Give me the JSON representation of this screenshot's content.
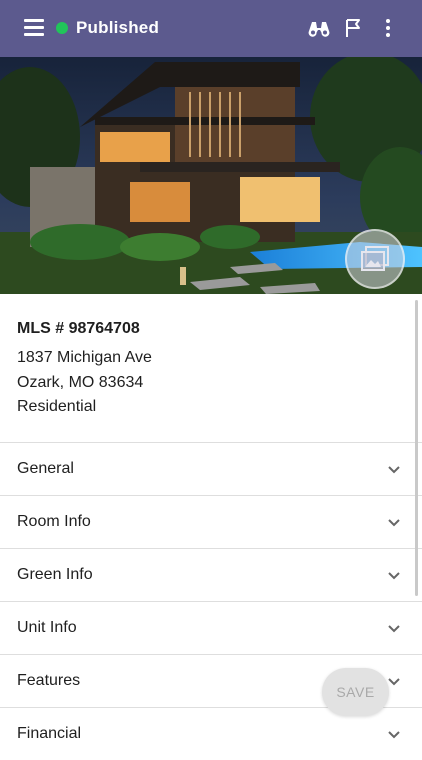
{
  "topbar": {
    "status_label": "Published",
    "status_color": "#21c45a",
    "bar_color": "#5c5a8e",
    "icons": [
      "menu-icon",
      "binoculars-icon",
      "flag-icon",
      "more-vert-icon"
    ]
  },
  "hero": {
    "gallery_icon": "gallery-icon"
  },
  "listing": {
    "mls": "MLS # 98764708",
    "street": "1837 Michigan Ave",
    "city_state_zip": "Ozark, MO 83634",
    "type": "Residential"
  },
  "sections": [
    {
      "label": "General"
    },
    {
      "label": "Room Info"
    },
    {
      "label": "Green Info"
    },
    {
      "label": "Unit Info"
    },
    {
      "label": "Features"
    },
    {
      "label": "Financial"
    }
  ],
  "save_label": "SAVE"
}
